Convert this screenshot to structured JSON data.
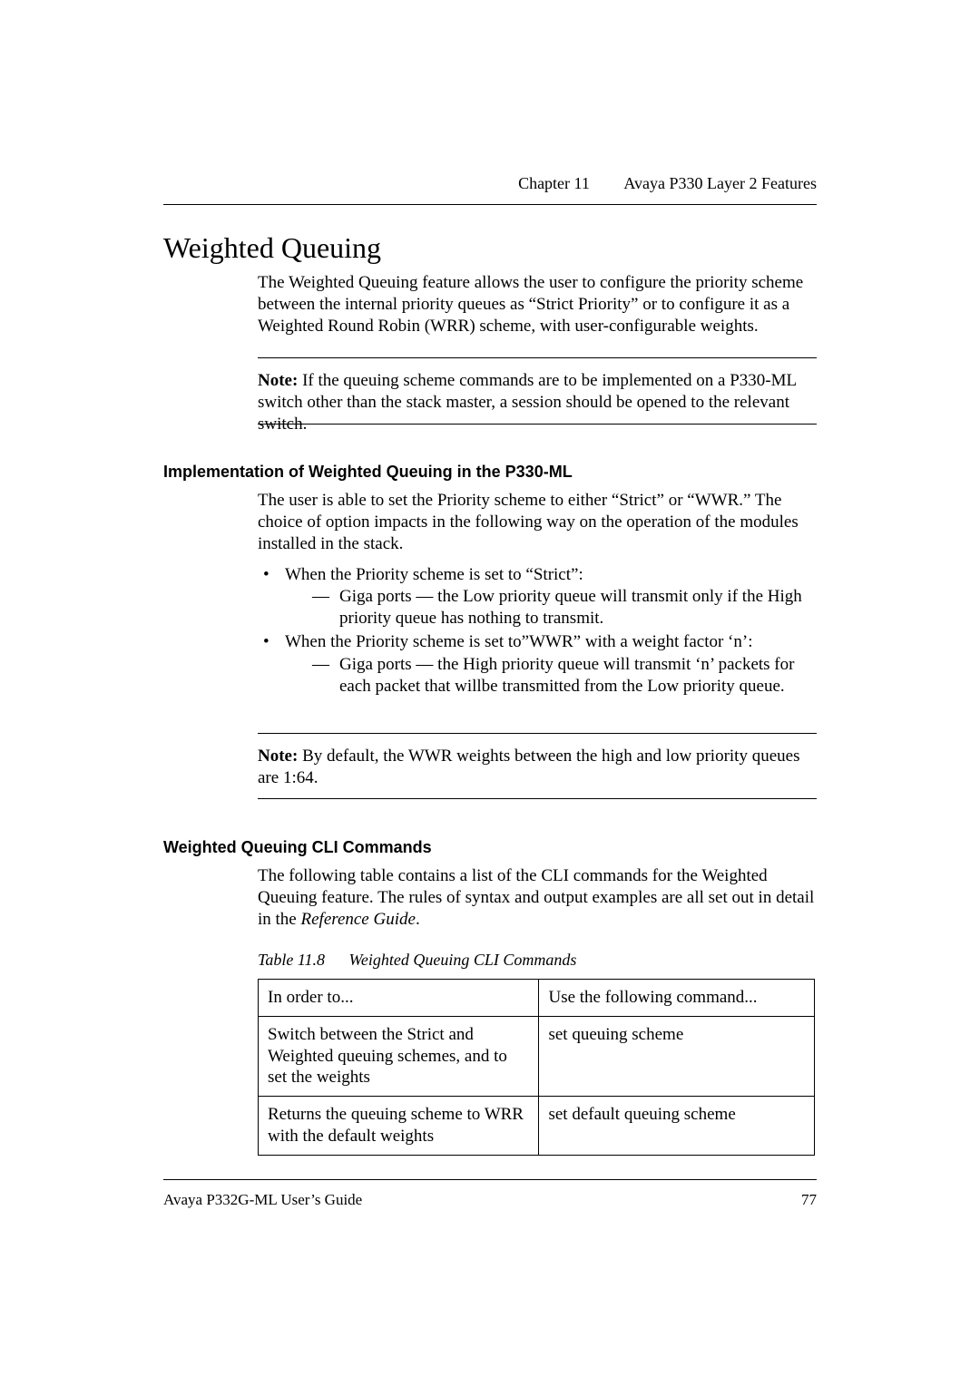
{
  "header": {
    "chapter": "Chapter 11",
    "title": "Avaya P330 Layer 2 Features"
  },
  "h1": "Weighted Queuing",
  "intro": "The Weighted Queuing feature allows the user to configure the priority scheme between the internal priority queues as “Strict Priority” or to configure it as a Weighted Round Robin (WRR) scheme, with user-configurable weights.",
  "note1_label": "Note:",
  "note1_text": "If the queuing scheme commands are to be implemented on a P330-ML switch other than the stack master, a session should be opened to the relevant switch.",
  "h3a": "Implementation of Weighted Queuing in the P330-ML",
  "para2": "The user is able to set the Priority scheme to either “Strict” or “WWR.” The choice of option impacts in the following way on the operation of the modules installed in the stack.",
  "bul1": "When the Priority scheme is set to “Strict”:",
  "bul1_sub": "Giga ports — the Low priority queue will transmit only if the High priority queue has nothing to transmit.",
  "bul2": "When the Priority scheme is set to”WWR” with a weight factor ‘n’:",
  "bul2_sub": "Giga ports — the High priority queue will transmit ‘n’ packets for each packet that willbe transmitted from the Low priority queue.",
  "note2_label": "Note:",
  "note2_text": "By default, the WWR weights between the high and low priority queues are 1:64.",
  "h3b": "Weighted Queuing CLI Commands",
  "para3_a": "The following table contains a list of the CLI commands for the Weighted Queuing feature. The rules of syntax and output examples are all set out in detail in the ",
  "para3_b": "Reference Guide",
  "para3_c": ".",
  "table_caption_num": "Table 11.8",
  "table_caption_title": "Weighted Queuing CLI Commands",
  "table": {
    "header": [
      "In order to...",
      "Use the following command..."
    ],
    "rows": [
      [
        "Switch between the Strict and Weighted queuing schemes, and to set the weights",
        "set queuing scheme"
      ],
      [
        "Returns the queuing scheme to WRR with the default weights",
        "set default queuing scheme"
      ]
    ]
  },
  "footer": {
    "left": "Avaya P332G-ML User’s Guide",
    "page": "77"
  }
}
